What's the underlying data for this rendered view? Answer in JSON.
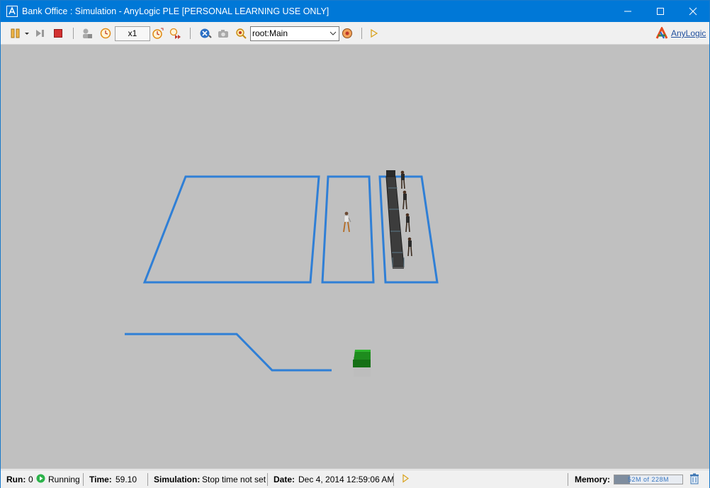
{
  "window": {
    "title": "Bank Office : Simulation - AnyLogic PLE [PERSONAL LEARNING USE ONLY]"
  },
  "toolbar": {
    "speed": "x1",
    "view_selector": {
      "selected": "root:Main"
    },
    "brand": "AnyLogic"
  },
  "statusbar": {
    "run_label": "Run:",
    "run_value": "0",
    "run_state": "Running",
    "time_label": "Time:",
    "time_value": "59.10",
    "simulation_label": "Simulation:",
    "simulation_value": "Stop time not set",
    "date_label": "Date:",
    "date_value": "Dec 4, 2014 12:59:06 AM",
    "memory_label": "Memory:",
    "memory_value": "52M of 228M",
    "memory_fraction": 0.23
  },
  "colors": {
    "titlebar": "#0078d7",
    "canvas": "#c0c0c0",
    "zone_outline": "#2f7fd6",
    "running": "#2cb34a",
    "stop": "#d33131"
  },
  "icons": [
    "pause-icon",
    "dropdown-icon",
    "step-icon",
    "stop-icon",
    "agent-icon",
    "clock-icon",
    "speed-up-icon",
    "fast-forward-icon",
    "experiment-icon",
    "camera-icon",
    "zoom-to-agent-icon",
    "navigate-icon",
    "step-toolbar-icon",
    "anylogic-logo",
    "running-icon",
    "memory-trash-icon"
  ]
}
